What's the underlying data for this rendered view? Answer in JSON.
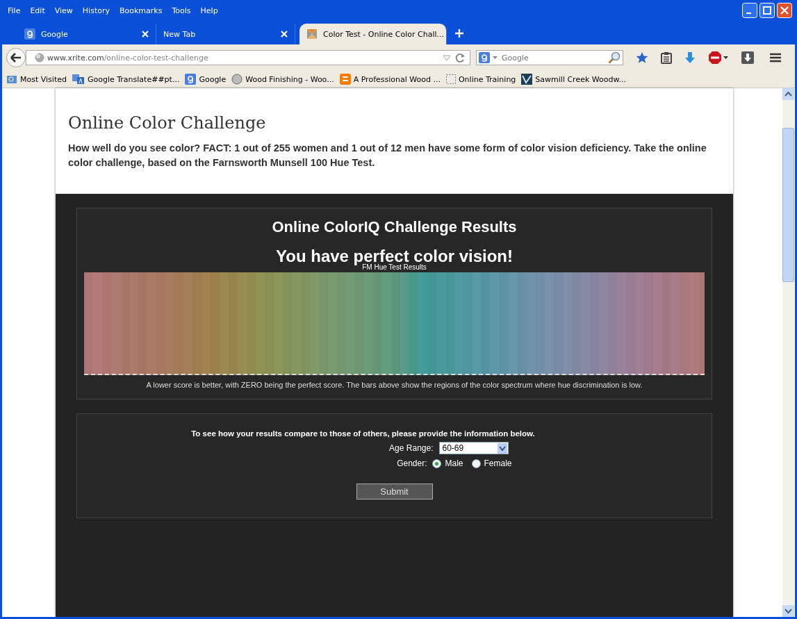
{
  "menu": [
    "File",
    "Edit",
    "View",
    "History",
    "Bookmarks",
    "Tools",
    "Help"
  ],
  "tabs": [
    {
      "title": "Google",
      "selected": false
    },
    {
      "title": "New Tab",
      "selected": false
    },
    {
      "title": "Color Test - Online Color Chall...",
      "selected": true
    }
  ],
  "address": {
    "host": "www.xrite.com",
    "path": "/online-color-test-challenge"
  },
  "search": {
    "placeholder": "Google"
  },
  "bookmarks": [
    {
      "label": "Most Visited"
    },
    {
      "label": "Google Translate##pt..."
    },
    {
      "label": "Google"
    },
    {
      "label": "Wood Finishing - Woo..."
    },
    {
      "label": "A Professional Wood ..."
    },
    {
      "label": "Online Training"
    },
    {
      "label": "Sawmill Creek Woodw..."
    }
  ],
  "page": {
    "heading": "Online Color Challenge",
    "intro": "How well do you see color? FACT: 1 out of 255 women and 1 out of 12 men have some form of color vision deficiency. Take the online color challenge, based on the Farnsworth Munsell 100 Hue Test.",
    "results_title": "Online ColorIQ Challenge Results",
    "result_message": "You have perfect color vision!",
    "chart_title": "FM Hue Test Results",
    "chart_note": "A lower score is better, with ZERO being the perfect score. The bars above show the regions of the color spectrum where hue discrimination is low.",
    "form": {
      "prompt": "To see how your results compare to those of others, please provide the information below.",
      "age_label": "Age Range:",
      "age_value": "60-69",
      "gender_label": "Gender:",
      "genders": [
        {
          "label": "Male",
          "selected": true
        },
        {
          "label": "Female",
          "selected": false
        }
      ],
      "submit": "Submit"
    }
  }
}
